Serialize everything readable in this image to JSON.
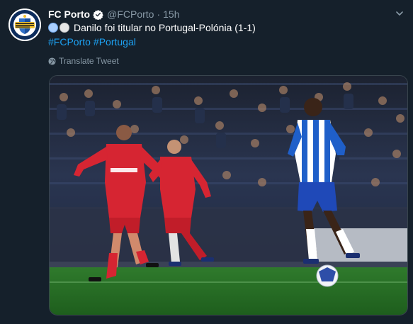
{
  "tweet": {
    "display_name": "FC Porto",
    "handle": "@FCPorto",
    "separator": "·",
    "time": "15h",
    "text": "Danilo foi titular no Portugal-Polónia (1-1)",
    "hashtags": [
      "#FCPorto",
      "#Portugal"
    ],
    "translate_label": "Translate Tweet",
    "emojis": [
      "blue-circle",
      "white-circle"
    ],
    "verified": true
  },
  "icons": {
    "verified": "verified-badge-icon",
    "menu": "chevron-down-icon",
    "translate": "globe-icon"
  },
  "colors": {
    "background": "#15202b",
    "text_primary": "#ffffff",
    "text_secondary": "#8899a6",
    "link": "#1da1f2",
    "border": "#38444d"
  }
}
